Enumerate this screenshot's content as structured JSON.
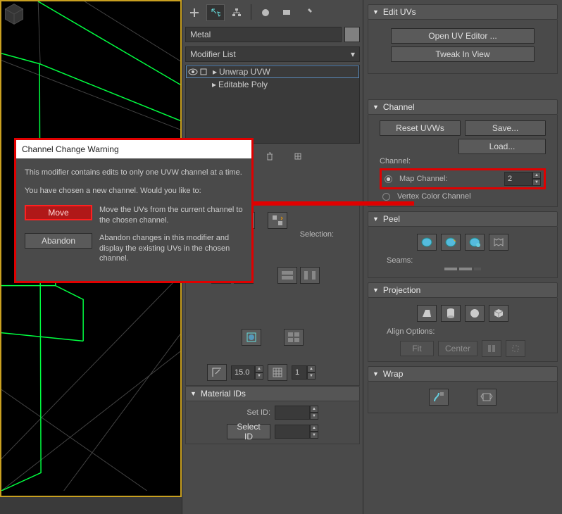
{
  "viewport": {
    "border_color": "#c9a020"
  },
  "object": {
    "name": "Metal"
  },
  "modifiers": {
    "list_label": "Modifier List",
    "stack": [
      {
        "name": "Unwrap UVW",
        "selected": true,
        "visible": true
      },
      {
        "name": "Editable Poly",
        "selected": false
      }
    ]
  },
  "dialog": {
    "title": "Channel Change Warning",
    "line1": "This modifier contains edits to only one UVW channel at a time.",
    "line2": "You have chosen a new channel. Would you like to:",
    "move_label": "Move",
    "move_desc": "Move the UVs from the current channel to the chosen channel.",
    "abandon_label": "Abandon",
    "abandon_desc": "Abandon changes in this modifier and display the existing UVs in the chosen channel."
  },
  "material_ids": {
    "header": "Material IDs",
    "set_id_label": "Set ID:",
    "select_id_label": "Select ID",
    "set_id_value": "",
    "select_id_value": ""
  },
  "selection_label": "Selection:",
  "edit_uvs": {
    "header": "Edit UVs",
    "open_btn": "Open UV Editor ...",
    "tweak_btn": "Tweak In View"
  },
  "channel": {
    "header": "Channel",
    "reset_btn": "Reset UVWs",
    "save_btn": "Save...",
    "load_btn": "Load...",
    "channel_label": "Channel:",
    "map_label": "Map Channel:",
    "map_value": "2",
    "vertex_label": "Vertex Color Channel"
  },
  "peel": {
    "header": "Peel",
    "seams_label": "Seams:"
  },
  "projection": {
    "header": "Projection",
    "align_label": "Align Options:",
    "fit_btn": "Fit",
    "center_btn": "Center"
  },
  "wrap": {
    "header": "Wrap"
  },
  "smoothing_value": "15.0",
  "grid_value": "1"
}
